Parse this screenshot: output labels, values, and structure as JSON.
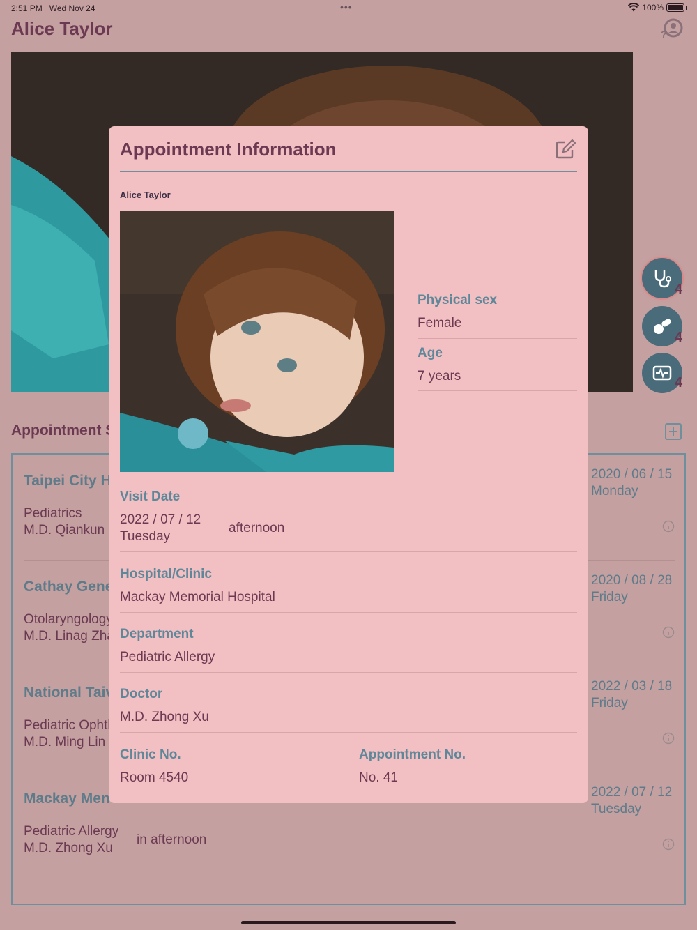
{
  "status": {
    "time": "2:51 PM",
    "date": "Wed Nov 24",
    "dots": "•••",
    "battery": "100%",
    "battery_level": 1.0
  },
  "header": {
    "title": "Alice Taylor"
  },
  "side_actions": [
    {
      "icon": "stethoscope-icon",
      "count": "4"
    },
    {
      "icon": "pills-icon",
      "count": "4"
    },
    {
      "icon": "heart-monitor-icon",
      "count": "4"
    }
  ],
  "appointments": {
    "header": "Appointment S",
    "rows": [
      {
        "hospital": "Taipei City H",
        "department": "Pediatrics",
        "doctor": "M.D. Qiankun L",
        "period": "",
        "date": "2020 / 06 / 15",
        "weekday": "Monday"
      },
      {
        "hospital": "Cathay Gene",
        "department": "Otolaryngology",
        "doctor": "M.D. Linag Zha",
        "period": "",
        "date": "2020 / 08 / 28",
        "weekday": "Friday"
      },
      {
        "hospital": "National Taiv",
        "department": "Pediatric Ophtl",
        "doctor": "M.D. Ming Lin",
        "period": "",
        "date": "2022 / 03 / 18",
        "weekday": "Friday"
      },
      {
        "hospital": "Mackay Men",
        "department": "Pediatric Allergy",
        "doctor": "M.D. Zhong Xu",
        "period": "in afternoon",
        "date": "2022 / 07 / 12",
        "weekday": "Tuesday"
      }
    ]
  },
  "modal": {
    "title": "Appointment Information",
    "patient_name": "Alice Taylor",
    "physical_sex_label": "Physical sex",
    "physical_sex": "Female",
    "age_label": "Age",
    "age": "7 years",
    "visit_date_label": "Visit Date",
    "visit_date": "2022 / 07 / 12",
    "visit_weekday": "Tuesday",
    "visit_period": "afternoon",
    "hospital_label": "Hospital/Clinic",
    "hospital": "Mackay Memorial Hospital",
    "department_label": "Department",
    "department": "Pediatric Allergy",
    "doctor_label": "Doctor",
    "doctor": "M.D. Zhong Xu",
    "clinic_label": "Clinic No.",
    "clinic": "Room 4540",
    "appt_no_label": "Appointment No.",
    "appt_no": "No. 41"
  },
  "colors": {
    "accent": "#5e8799",
    "text": "#6b3a52",
    "modal_bg": "#f2bfc2",
    "backdrop": "#c4a0a0"
  }
}
